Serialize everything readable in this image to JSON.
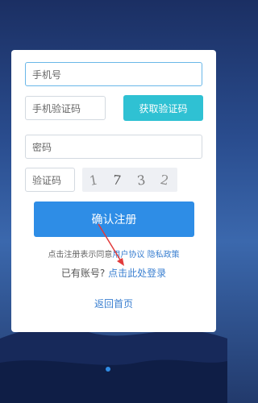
{
  "form": {
    "phone_placeholder": "手机号",
    "sms_code_placeholder": "手机验证码",
    "get_code_label": "获取验证码",
    "password_placeholder": "密码",
    "captcha_placeholder": "验证码",
    "captcha_chars": [
      "1",
      "7",
      "3",
      "2"
    ],
    "submit_label": "确认注册"
  },
  "agreement": {
    "prefix": "点击注册表示同意",
    "user_agreement": "用户协议",
    "privacy_policy": "隐私政策"
  },
  "login": {
    "prefix": "已有账号?",
    "link": "点击此处登录"
  },
  "home_link": "返回首页",
  "colors": {
    "primary": "#2e8de6",
    "accent": "#2fc1d3",
    "link": "#3a7fd0"
  }
}
